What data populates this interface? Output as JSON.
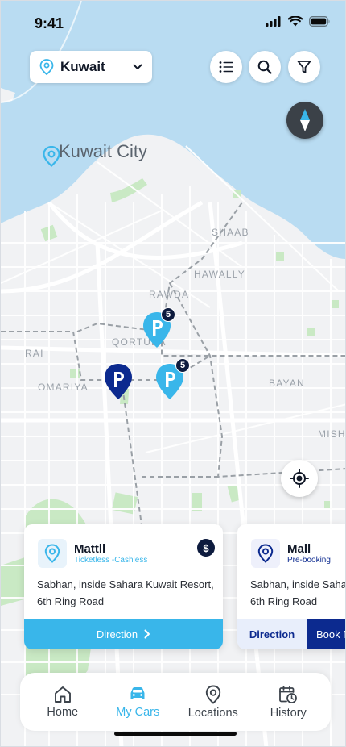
{
  "status_bar": {
    "time": "9:41"
  },
  "top_bar": {
    "country": "Kuwait",
    "list_icon": "list-icon",
    "search_icon": "search-icon",
    "filter_icon": "filter-icon"
  },
  "map": {
    "city_name": "Kuwait City",
    "areas": [
      "SHAAB",
      "HAWALLY",
      "RAWDA",
      "QORTUBA",
      "RAI",
      "OMARIYA",
      "BAYAN",
      "MISH"
    ],
    "pins": [
      {
        "count": "5",
        "tone": "light"
      },
      {
        "count": "5",
        "tone": "light"
      },
      {
        "count": "",
        "tone": "dark"
      }
    ]
  },
  "cards": [
    {
      "title": "Mattll",
      "subtitle": "Ticketless -Cashless",
      "address_line1": "Sabhan, inside Sahara Kuwait Resort,",
      "address_line2": "6th Ring Road",
      "badge": "$",
      "action": "Direction"
    },
    {
      "title": "Mall",
      "subtitle": "Pre-booking",
      "address_line1": "Sabhan, inside Sahar",
      "address_line2": "6th Ring Road",
      "action_direction": "Direction",
      "action_book": "Book N"
    }
  ],
  "nav": {
    "items": [
      {
        "label": "Home",
        "icon": "home-icon",
        "active": false
      },
      {
        "label": "My Cars",
        "icon": "car-icon",
        "active": true
      },
      {
        "label": "Locations",
        "icon": "location-pin-icon",
        "active": false
      },
      {
        "label": "History",
        "icon": "history-calendar-icon",
        "active": false
      }
    ]
  },
  "colors": {
    "accent": "#39b6ea",
    "navy": "#0d1b3e",
    "deep_blue": "#0c2a8f",
    "water": "#b9dcf2",
    "land": "#f1f2f4",
    "park": "#c9e9c4"
  }
}
